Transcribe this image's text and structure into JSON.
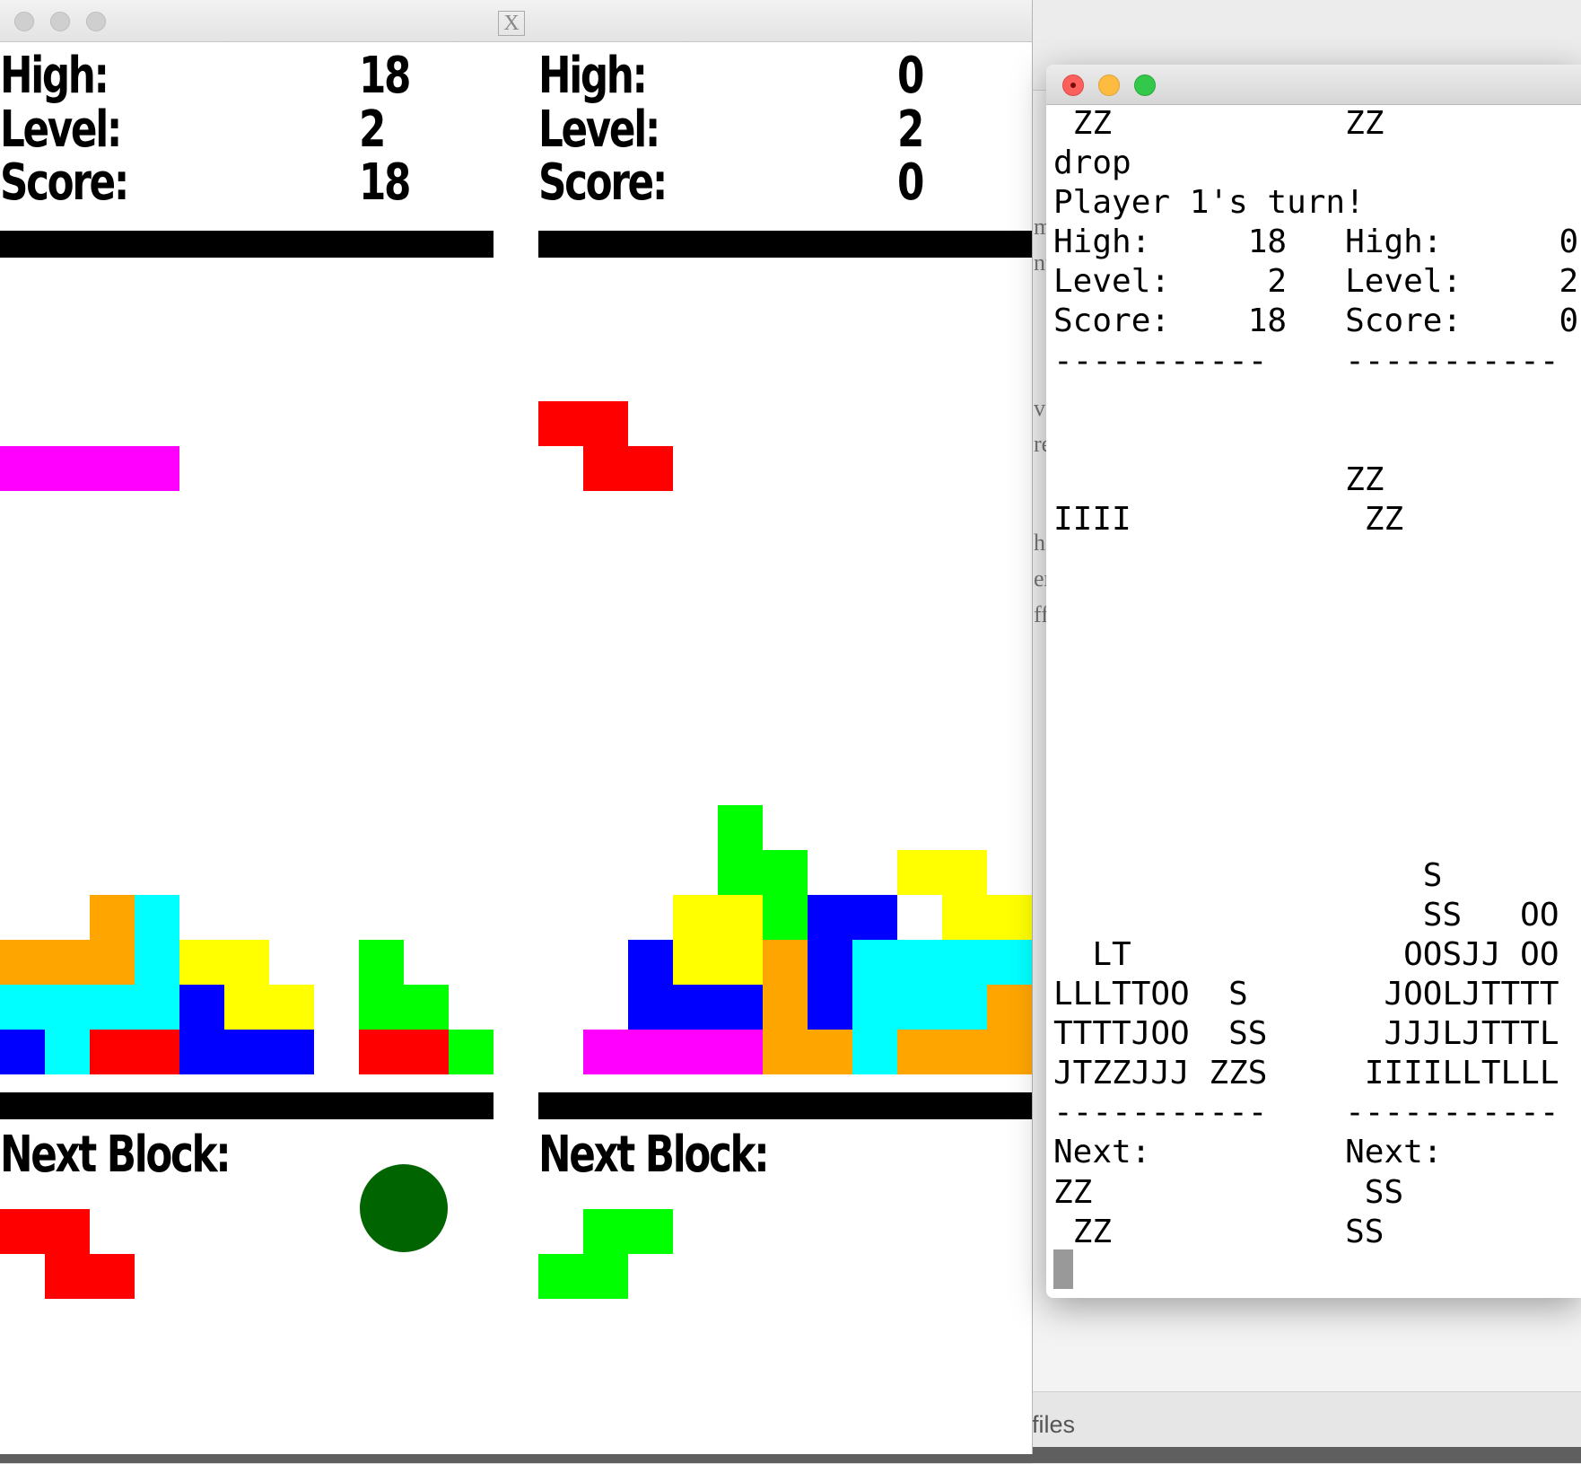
{
  "background": {
    "files_text": "files"
  },
  "x11_window": {
    "logo": "X",
    "board_left": {
      "high_label": "High:",
      "high_value": "18",
      "level_label": "Level:",
      "level_value": "2",
      "score_label": "Score:",
      "score_value": "18",
      "next_label": "Next Block:"
    },
    "board_right": {
      "high_label": "High:",
      "high_value": "0",
      "level_label": "Level:",
      "level_value": "2",
      "score_label": "Score:",
      "score_value": "0",
      "next_label": "Next Block:"
    },
    "colors": {
      "I": "#ff00ff",
      "Z": "#ff0000",
      "S": "#00ff00",
      "O": "#ffff00",
      "L": "#ffa500",
      "J": "#0000ff",
      "T": "#00ffff",
      "turn_indicator": "#006400"
    },
    "left_grid_rows": [
      "          ",
      "          ",
      "          ",
      "IIII      ",
      "          ",
      "          ",
      "          ",
      "          ",
      "          ",
      "          ",
      "          ",
      "          ",
      "          ",
      "  LT      ",
      "LLLTOO  S ",
      "TTTTJOO SS",
      "JTZZJJJ ZZS"
    ],
    "right_grid_rows": [
      "          ",
      "          ",
      "ZZ        ",
      " ZZ       ",
      "          ",
      "          ",
      "          ",
      "          ",
      "          ",
      "          ",
      "          ",
      "    S     ",
      "    SS  OO",
      "   OOSJJ OO",
      "  JOOLJTTTT",
      "  JJJLJTTTL",
      " IIIILLTLLL"
    ],
    "left_next": [
      "ZZ ",
      " ZZ"
    ],
    "right_next": [
      " SS",
      "SS "
    ]
  },
  "terminal": {
    "lines": [
      " ZZ            ZZ",
      "drop",
      "Player 1's turn!",
      "High:     18   High:      0",
      "Level:     2   Level:     2",
      "Score:    18   Score:     0",
      "-----------    -----------",
      "",
      "",
      "               ZZ",
      "IIII            ZZ",
      "",
      "",
      "",
      "",
      "",
      "",
      "",
      "",
      "                   S",
      "                   SS   OO",
      "  LT              OOSJJ OO",
      "LLLTTOO  S       JOOLJTTTT",
      "TTTTJOO  SS      JJJLJTTTL",
      "JTZZJJJ ZZS     IIIILLTLLL",
      "-----------    -----------",
      "Next:          Next:",
      "ZZ              SS",
      " ZZ            SS"
    ]
  }
}
